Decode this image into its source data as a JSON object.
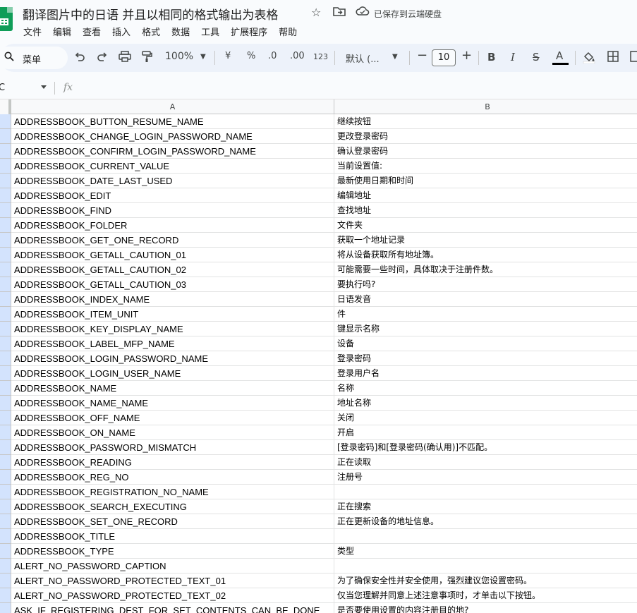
{
  "title": {
    "doc_name": "翻译图片中的日语  并且以相同的格式输出为表格",
    "saved_status": "已保存到云端硬盘"
  },
  "menu": [
    "文件",
    "编辑",
    "查看",
    "插入",
    "格式",
    "数据",
    "工具",
    "扩展程序",
    "帮助"
  ],
  "toolbar": {
    "search_label": "菜单",
    "zoom": "100%",
    "currency": "¥",
    "percent": "%",
    "dec_decrease": ".0",
    "dec_increase": ".00",
    "number_format": "123",
    "font": "默认 (...",
    "font_size": "10",
    "bold": "B",
    "italic": "I",
    "strike": "S",
    "text_color": "A"
  },
  "formula_bar": {
    "name_box": "C",
    "fx": "fx"
  },
  "columns": [
    "A",
    "B"
  ],
  "rows": [
    [
      "ADDRESSBOOK_BUTTON_RESUME_NAME",
      "继续按钮"
    ],
    [
      "ADDRESSBOOK_CHANGE_LOGIN_PASSWORD_NAME",
      "更改登录密码"
    ],
    [
      "ADDRESSBOOK_CONFIRM_LOGIN_PASSWORD_NAME",
      "确认登录密码"
    ],
    [
      "ADDRESSBOOK_CURRENT_VALUE",
      "当前设置值:"
    ],
    [
      "ADDRESSBOOK_DATE_LAST_USED",
      "最新使用日期和时间"
    ],
    [
      "ADDRESSBOOK_EDIT",
      "编辑地址"
    ],
    [
      "ADDRESSBOOK_FIND",
      "查找地址"
    ],
    [
      "ADDRESSBOOK_FOLDER",
      "文件夹"
    ],
    [
      "ADDRESSBOOK_GET_ONE_RECORD",
      "获取一个地址记录"
    ],
    [
      "ADDRESSBOOK_GETALL_CAUTION_01",
      "将从设备获取所有地址簿。"
    ],
    [
      "ADDRESSBOOK_GETALL_CAUTION_02",
      "可能需要一些时间，具体取决于注册件数。"
    ],
    [
      "ADDRESSBOOK_GETALL_CAUTION_03",
      "要执行吗?"
    ],
    [
      "ADDRESSBOOK_INDEX_NAME",
      "日语发音"
    ],
    [
      "ADDRESSBOOK_ITEM_UNIT",
      "件"
    ],
    [
      "ADDRESSBOOK_KEY_DISPLAY_NAME",
      "键显示名称"
    ],
    [
      "ADDRESSBOOK_LABEL_MFP_NAME",
      "设备"
    ],
    [
      "ADDRESSBOOK_LOGIN_PASSWORD_NAME",
      "登录密码"
    ],
    [
      "ADDRESSBOOK_LOGIN_USER_NAME",
      "登录用户名"
    ],
    [
      "ADDRESSBOOK_NAME",
      "名称"
    ],
    [
      "ADDRESSBOOK_NAME_NAME",
      "地址名称"
    ],
    [
      "ADDRESSBOOK_OFF_NAME",
      "关闭"
    ],
    [
      "ADDRESSBOOK_ON_NAME",
      "开启"
    ],
    [
      "ADDRESSBOOK_PASSWORD_MISMATCH",
      "[登录密码]和[登录密码(确认用)]不匹配。"
    ],
    [
      "ADDRESSBOOK_READING",
      "正在读取"
    ],
    [
      "ADDRESSBOOK_REG_NO",
      "注册号"
    ],
    [
      "ADDRESSBOOK_REGISTRATION_NO_NAME",
      ""
    ],
    [
      "ADDRESSBOOK_SEARCH_EXECUTING",
      "正在搜索"
    ],
    [
      "ADDRESSBOOK_SET_ONE_RECORD",
      "正在更新设备的地址信息。"
    ],
    [
      "ADDRESSBOOK_TITLE",
      ""
    ],
    [
      "ADDRESSBOOK_TYPE",
      "类型"
    ],
    [
      "ALERT_NO_PASSWORD_CAPTION",
      ""
    ],
    [
      "ALERT_NO_PASSWORD_PROTECTED_TEXT_01",
      "为了确保安全性并安全使用，强烈建议您设置密码。"
    ],
    [
      "ALERT_NO_PASSWORD_PROTECTED_TEXT_02",
      "仅当您理解并同意上述注意事项时，才单击以下按钮。"
    ],
    [
      "ASK_IF_REGISTERING_DEST_FOR_SET_CONTENTS_CAN_BE_DONE",
      "是否要使用设置的内容注册目的地?"
    ]
  ]
}
